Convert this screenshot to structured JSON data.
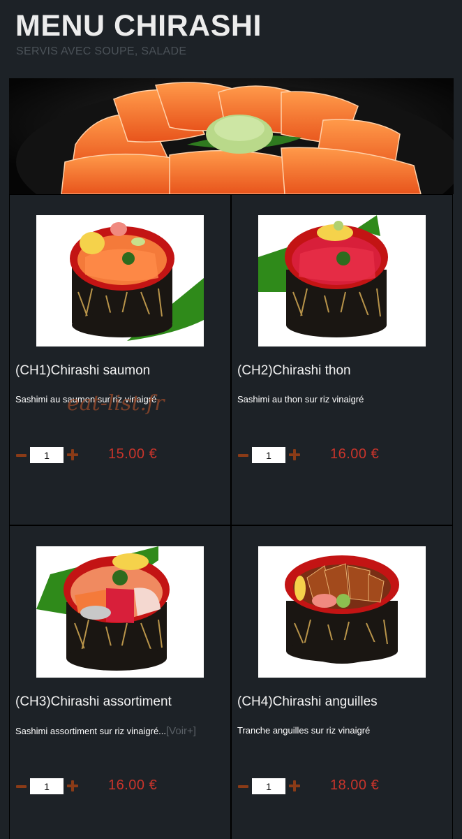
{
  "header": {
    "title": "MENU CHIRASHI",
    "subtitle": "SERVIS AVEC SOUPE, SALADE"
  },
  "watermark": "eat-list.fr",
  "colors": {
    "background": "#1d2227",
    "price": "#c8342b",
    "stepper": "#8a3b17"
  },
  "items": [
    {
      "name": "(CH1)Chirashi saumon",
      "description": "Sashimi au saumon sur riz vinaigré",
      "more": "",
      "quantity": "1",
      "price": "15.00 €",
      "image": "salmon-chirashi-bowl"
    },
    {
      "name": "(CH2)Chirashi thon",
      "description": "Sashimi au thon sur riz vinaigré",
      "more": "",
      "quantity": "1",
      "price": "16.00 €",
      "image": "tuna-chirashi-bowl"
    },
    {
      "name": "(CH3)Chirashi assortiment",
      "description": "Sashimi assortiment sur riz vinaigré...",
      "more": "[Voir+]",
      "quantity": "1",
      "price": "16.00 €",
      "image": "assorted-chirashi-bowl"
    },
    {
      "name": "(CH4)Chirashi anguilles",
      "description": "Tranche anguilles sur riz vinaigré",
      "more": "",
      "quantity": "1",
      "price": "18.00 €",
      "image": "eel-chirashi-bowl"
    }
  ]
}
